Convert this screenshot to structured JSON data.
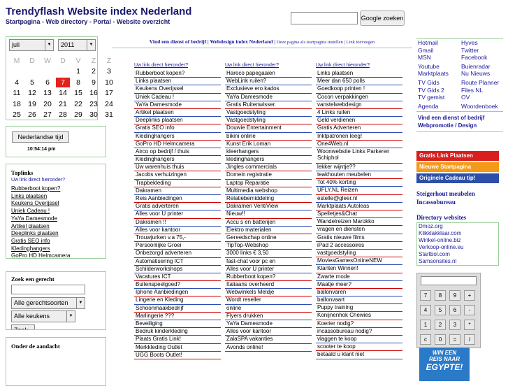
{
  "header": {
    "title": "Trendyflash Website index Nederland",
    "subtitle": "Startpagina - Web directory - Portal - Website overzicht",
    "search_button": "Google zoeken"
  },
  "calendar": {
    "month": "juli",
    "year": "2011",
    "weekdays": [
      "M",
      "D",
      "W",
      "D",
      "V",
      "Z",
      "Z"
    ],
    "weeks": [
      [
        "",
        "",
        "",
        "",
        "1",
        "2",
        "3"
      ],
      [
        "4",
        "5",
        "6",
        "7",
        "8",
        "9",
        "10"
      ],
      [
        "11",
        "12",
        "13",
        "14",
        "15",
        "16",
        "17"
      ],
      [
        "18",
        "19",
        "20",
        "21",
        "22",
        "23",
        "24"
      ],
      [
        "25",
        "26",
        "27",
        "28",
        "29",
        "30",
        "31"
      ]
    ],
    "today": "7"
  },
  "clock": {
    "button": "Nederlandse tijd",
    "time": "10:54:14 pm"
  },
  "toplinks": {
    "title": "Toplinks",
    "note": "Uw link direct hieronder?",
    "items": [
      "Rubberboot kopen?",
      "Links plaatsen",
      "Keukens Overijssel",
      "Uniek Cadeau !",
      "YaYa Damesmode",
      "Artikel plaatsen",
      "Deeplinks plaatsen",
      "Gratis SEO info",
      "Kledinghangers",
      "GoPro HD Helmcamera"
    ]
  },
  "zoek": {
    "title": "Zoek een gerecht",
    "opt1": "Alle gerechtsoorten",
    "opt2": "Alle keukens",
    "button": "Zoek"
  },
  "aandacht": {
    "title": "Onder de aandacht"
  },
  "topbar": {
    "main": "Vind een dienst of bedrijf | Webdesign index Nederland |",
    "start": "Deze pagina als startpagina instellen",
    "toev": "| Link toevoegen"
  },
  "col_header": "Uw link direct hieronder?",
  "col1": [
    "Rubberboot kopen?",
    "Links plaatsen",
    "Keukens Overijssel",
    "Uniek Cadeau !",
    "YaYa Damesmode",
    "Artikel plaatsen",
    "Deeplinks plaatsen",
    "Gratis SEO info",
    "Kledinghangers",
    "GoPro HD Helmcamera",
    "Airco op bedrijf / thuis",
    "Kledinghangers",
    "Uw warenhuis thuis",
    "Jacobs verhuizingen",
    "Trapbekleding",
    "Dakramen",
    "Reis Aanbiedingen",
    "Gratis adverteren",
    "Alles voor U printer",
    "Dakramen !!",
    "Alles voor kantoor",
    "Trouwjurken v.a 75,-",
    "Persoonlijke Groei",
    "Onbezorgd adverteren",
    "Automatisering ICT",
    "Schilderworkshops",
    "Vacatures ICT",
    "Buitenspeelgoed?",
    "Iphone Aanbiedingen",
    "Lingerie en Kleding",
    "Schoonmaakbedrijf",
    "Marlingerie ???",
    "Beveiliging",
    "Bedruk kinderkleding",
    "Plaats Gratis Link!",
    "Merkkleding Outlet",
    "UGG Boots Outlet!"
  ],
  "col2": [
    "Hareco papegaaien",
    "WebLink ruilen?",
    "Exclusieve ero kados",
    "YaYa Damesmode",
    "Gratis Ruitenwisser.",
    "Vastgoedstyling",
    "Vastgoedstyling",
    "Douwie Entertainment",
    "bikini online",
    "Kunst Erik Loman",
    "kleerhangers",
    "kledinghangers",
    "Jingles commercials",
    "Domein registratie",
    "Laptop Reparatie",
    "Multimedia webshop",
    "Relatiebemiddeling",
    "Dakramen VentiView",
    "Nieuw!!",
    "Accu s en batterijen",
    "Elektro materialen",
    "Gereedschap online",
    "TipTop-Webshop",
    "3000 links € 3,50",
    "fast-chat voor pc en",
    "Alles voor U printer",
    "Rubberboot kopen?",
    "Italiaans overheerd",
    "Webwinkels Meldje",
    "Wordt reseller",
    "online",
    "Flyers drukken",
    "YaYa Damesmode",
    "Alles voor kantoor",
    "ZalaSPA vakanties",
    "Avonds online!"
  ],
  "col3": [
    "Links plaatsen",
    "Meer dan 650 polls",
    "Goedkoop printen !",
    "Cocon verpakkingen",
    "vanstelwebdesign",
    "4 Links ruilen",
    "Geld verdienen",
    "Gratis Adverteren",
    "Inktpatronen leeg!",
    "One4Web.nl",
    "Woonwebsite Links Parkeren Schiphol",
    "lekker wijntje??",
    "teakhouten meubelen",
    "Tot 40% korting",
    "UFLY.NL Reizen",
    "estelle@gleer.nl",
    "Marktplaats Autoleas",
    "Spelletjes&Chat",
    "Wandelreizen Marokko",
    "vragen en diensten",
    "Gratis nieuwe films",
    "iPad 2 accessoires",
    "vastgoedstyling",
    "MoviesGamesOnlineNEW",
    "Klanten Winnen!",
    "Zwarte mode",
    "Maatje meer?",
    "ballonvaren",
    "ballonvaart",
    "Puppy training",
    "Konijnenhok Chewies",
    "Koerier nodig?",
    "incassobureau nodig?",
    "vlaggen te koop",
    "scooter te koop",
    "betaald u klant niet"
  ],
  "nav": [
    [
      "Hotmail",
      "Hyves"
    ],
    [
      "Gmail",
      "Twitter"
    ],
    [
      "MSN",
      "Facebook"
    ],
    [
      "Youtube",
      "Buienradar"
    ],
    [
      "Marktplaats",
      "Nu Nieuws"
    ],
    [
      "TV Gids",
      "Route Planner"
    ],
    [
      "TV Gids 2",
      "Files NL"
    ],
    [
      "TV gemist",
      "OV"
    ],
    [
      "Agenda",
      "Woordenboek"
    ]
  ],
  "nav_bold": [
    "Vind een dienst of bedrijf",
    "Webpromotie / Design"
  ],
  "banners": [
    "Gratis Link Plaatsen",
    "Nieuwe Startpagina",
    "Originele Cadeau tip!"
  ],
  "serif_links": [
    "Steigerhout meubelen",
    "Incassobureau"
  ],
  "dir": {
    "title": "Directory websites",
    "items": [
      "Dmoz.org",
      "Klikklakklaar.com",
      "Winkel-online.biz",
      "Verkoop-online.eu",
      "Startbol.com",
      "Samsonsites.nl"
    ]
  },
  "calc": [
    "7",
    "8",
    "9",
    "+",
    "4",
    "5",
    "6",
    "-",
    "1",
    "2",
    "3",
    "*",
    "c",
    "0",
    "=",
    "/"
  ],
  "ad": {
    "line1": "WIN EEN",
    "line2": "REIS NAAR",
    "line3": "EGYPTE!"
  }
}
